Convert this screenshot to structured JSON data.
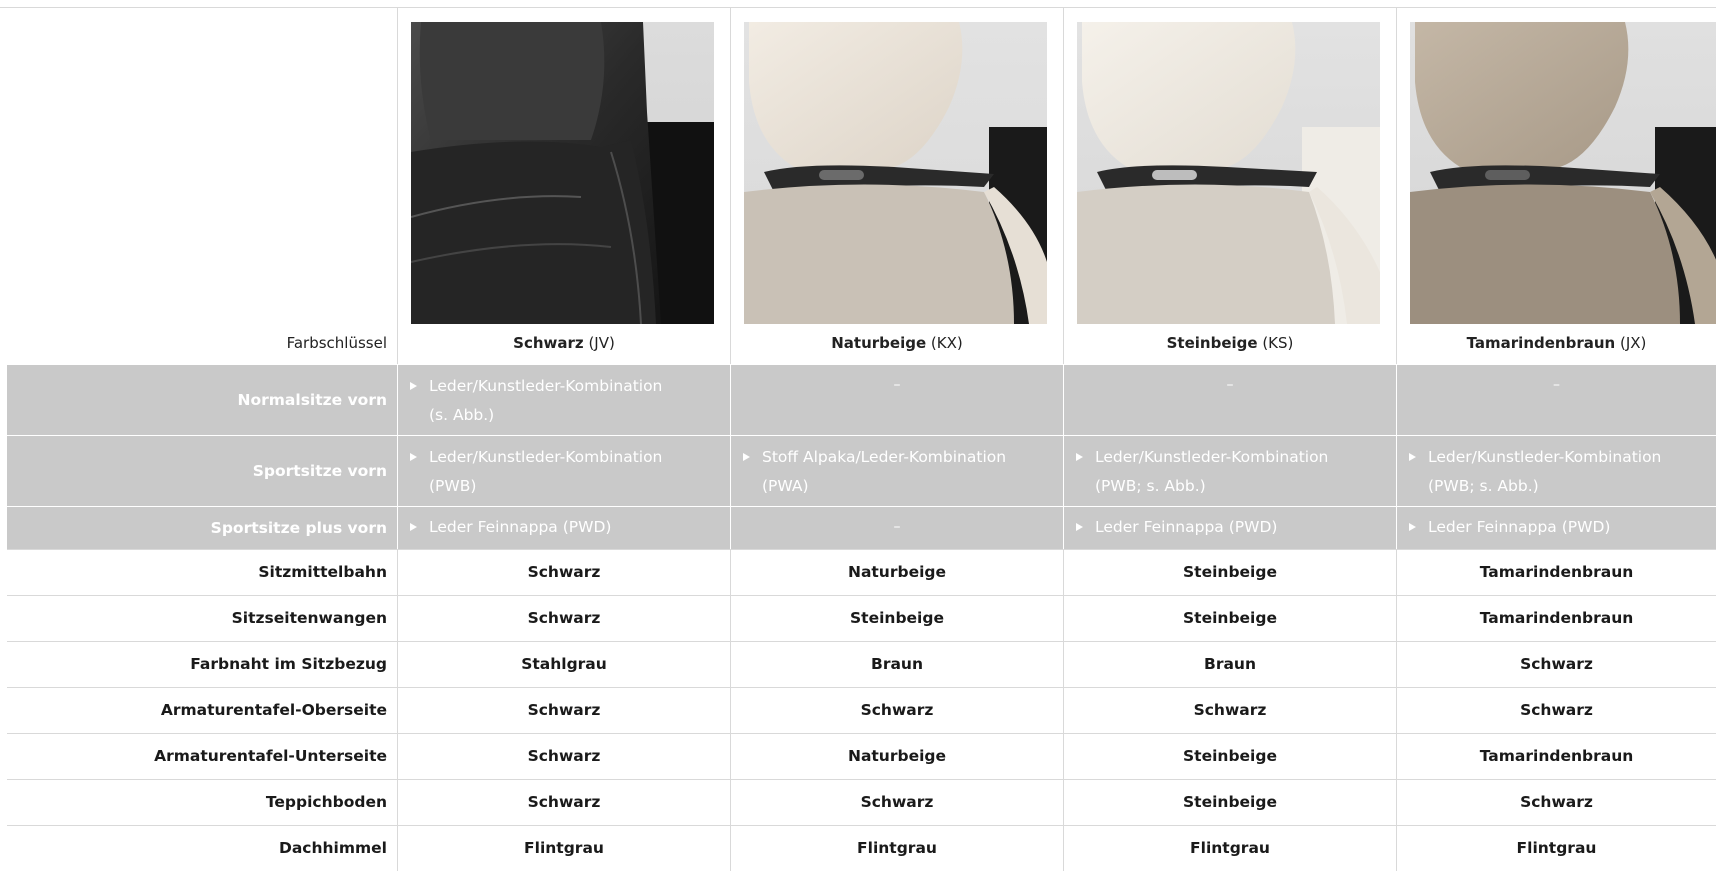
{
  "header": {
    "color_key_label": "Farbschlüssel",
    "colors": [
      {
        "name": "Schwarz",
        "code": "(JV)",
        "image": "seat-schwarz-image"
      },
      {
        "name": "Naturbeige",
        "code": "(KX)",
        "image": "seat-naturbeige-image"
      },
      {
        "name": "Steinbeige",
        "code": "(KS)",
        "image": "seat-steinbeige-image"
      },
      {
        "name": "Tamarindenbraun",
        "code": "(JX)",
        "image": "seat-tamarindenbraun-image"
      }
    ]
  },
  "gray_rows": [
    {
      "label": "Normalsitze vorn",
      "cells": [
        {
          "line1": "Leder/Kunstleder-Kombination",
          "line2": "(s. Abb.)"
        },
        {
          "dash": "–"
        },
        {
          "dash": "–"
        },
        {
          "dash": "–"
        }
      ]
    },
    {
      "label": "Sportsitze vorn",
      "cells": [
        {
          "line1": "Leder/Kunstleder-Kombination",
          "line2": "(PWB)"
        },
        {
          "line1": "Stoff Alpaka/Leder-Kombination",
          "line2": "(PWA)"
        },
        {
          "line1": "Leder/Kunstleder-Kombination",
          "line2": "(PWB; s. Abb.)"
        },
        {
          "line1": "Leder/Kunstleder-Kombination",
          "line2": "(PWB; s. Abb.)"
        }
      ]
    },
    {
      "label": "Sportsitze plus vorn",
      "cells": [
        {
          "line1": "Leder Feinnappa (PWD)"
        },
        {
          "dash": "–"
        },
        {
          "line1": "Leder Feinnappa (PWD)"
        },
        {
          "line1": "Leder Feinnappa (PWD)"
        }
      ]
    }
  ],
  "rows": [
    {
      "label": "Sitzmittelbahn",
      "values": [
        "Schwarz",
        "Naturbeige",
        "Steinbeige",
        "Tamarindenbraun"
      ]
    },
    {
      "label": "Sitzseitenwangen",
      "values": [
        "Schwarz",
        "Steinbeige",
        "Steinbeige",
        "Tamarindenbraun"
      ]
    },
    {
      "label": "Farbnaht im Sitzbezug",
      "values": [
        "Stahlgrau",
        "Braun",
        "Braun",
        "Schwarz"
      ]
    },
    {
      "label": "Armaturentafel-Oberseite",
      "values": [
        "Schwarz",
        "Schwarz",
        "Schwarz",
        "Schwarz"
      ]
    },
    {
      "label": "Armaturentafel-Unterseite",
      "values": [
        "Schwarz",
        "Naturbeige",
        "Steinbeige",
        "Tamarindenbraun"
      ]
    },
    {
      "label": "Teppichboden",
      "values": [
        "Schwarz",
        "Schwarz",
        "Steinbeige",
        "Schwarz"
      ]
    },
    {
      "label": "Dachhimmel",
      "values": [
        "Flintgrau",
        "Flintgrau",
        "Flintgrau",
        "Flintgrau"
      ]
    }
  ],
  "colors": {
    "gray_row_bg": "#c9c9c9",
    "divider": "#d9d9d9",
    "text": "#1a1a1a"
  }
}
